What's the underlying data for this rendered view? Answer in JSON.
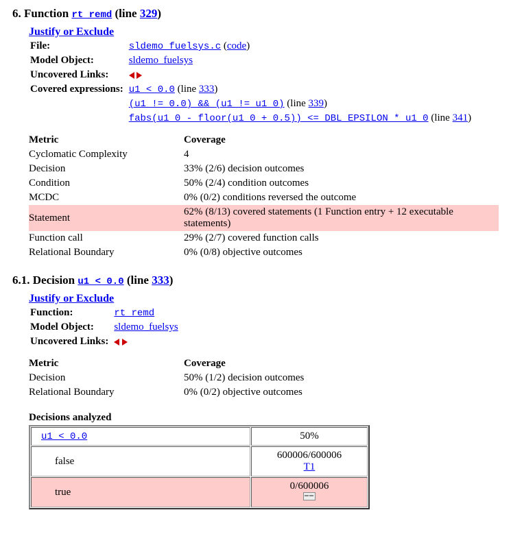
{
  "section1": {
    "heading_prefix": "6. Function ",
    "func_name": "rt_remd",
    "line_label": " (line ",
    "line_num": "329",
    "paren_close": ")",
    "justify": "Justify or Exclude",
    "meta": {
      "file_label": "File:",
      "file_link": "sldemo_fuelsys.c",
      "file_sfx_open": " (",
      "file_code": "code",
      "file_sfx_close": ")",
      "model_label": "Model Object:",
      "model_link": "sldemo_fuelsys",
      "uncov_label": "Uncovered Links:",
      "covexp_label": "Covered expressions:",
      "exp1": "u1 < 0.0",
      "exp1_line": "333",
      "exp2": "(u1 != 0.0) && (u1 != u1_0)",
      "exp2_line": "339",
      "exp3": "fabs(u1_0 - floor(u1_0 + 0.5)) <= DBL_EPSILON * u1_0",
      "exp3_line": "341"
    },
    "metrics": {
      "h1": "Metric",
      "h2": "Coverage",
      "rows": [
        {
          "m": "Cyclomatic Complexity",
          "c": "4"
        },
        {
          "m": "Decision",
          "c": "33% (2/6) decision outcomes"
        },
        {
          "m": "Condition",
          "c": "50% (2/4) condition outcomes"
        },
        {
          "m": "MCDC",
          "c": "0% (0/2) conditions reversed the outcome"
        },
        {
          "m": "Statement",
          "c": "62% (8/13) covered statements (1 Function entry + 12 executable statements)",
          "hl": true
        },
        {
          "m": "Function call",
          "c": "29% (2/7) covered function calls"
        },
        {
          "m": "Relational Boundary",
          "c": "0% (0/8) objective outcomes"
        }
      ]
    }
  },
  "section2": {
    "heading_prefix": "6.1. Decision ",
    "expr": "u1 < 0.0",
    "line_label": " (line ",
    "line_num": "333",
    "paren_close": ")",
    "justify": "Justify or Exclude",
    "meta": {
      "func_label": "Function:",
      "func_link": "rt_remd",
      "model_label": "Model Object:",
      "model_link": "sldemo_fuelsys",
      "uncov_label": "Uncovered Links:"
    },
    "metrics": {
      "h1": "Metric",
      "h2": "Coverage",
      "rows": [
        {
          "m": "Decision",
          "c": "50% (1/2) decision outcomes"
        },
        {
          "m": "Relational Boundary",
          "c": "0% (0/2) objective outcomes"
        }
      ]
    },
    "analyzed_label": "Decisions analyzed",
    "dec": {
      "cond": "u1 < 0.0",
      "pct": "50%",
      "false_lbl": "false",
      "false_val": "600006/600006",
      "false_link": "T1",
      "true_lbl": "true",
      "true_val": "0/600006"
    }
  }
}
